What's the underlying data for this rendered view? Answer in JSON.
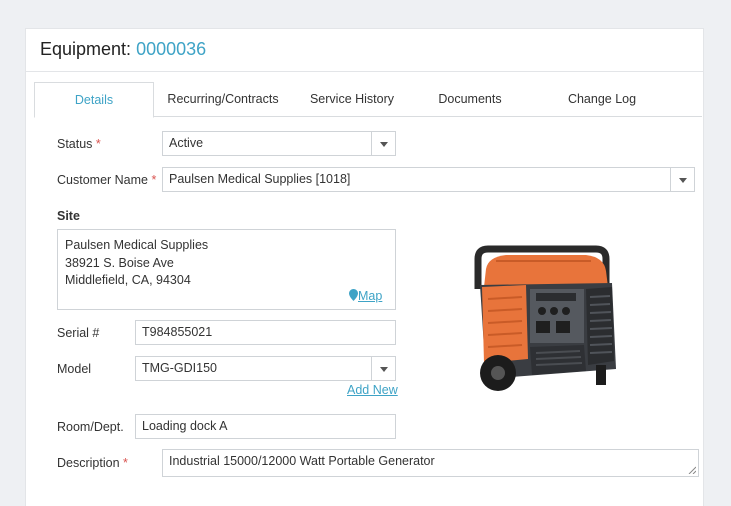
{
  "header": {
    "title": "Equipment:",
    "number": "0000036"
  },
  "tabs": [
    {
      "label": "Details",
      "active": true
    },
    {
      "label": "Recurring/Contracts",
      "active": false
    },
    {
      "label": "Service History",
      "active": false
    },
    {
      "label": "Documents",
      "active": false
    },
    {
      "label": "Change Log",
      "active": false
    }
  ],
  "form": {
    "status": {
      "label": "Status",
      "required": "*",
      "value": "Active"
    },
    "customer": {
      "label": "Customer Name",
      "required": "*",
      "value": "Paulsen Medical Supplies [1018]"
    },
    "site": {
      "label": "Site",
      "line1": "Paulsen Medical Supplies",
      "line2": "38921 S. Boise Ave",
      "line3": "Middlefield, CA, 94304",
      "map_link": "Map"
    },
    "serial": {
      "label": "Serial #",
      "value": "T984855021"
    },
    "model": {
      "label": "Model",
      "value": "TMG-GDI150",
      "add_new": "Add New"
    },
    "room": {
      "label": "Room/Dept.",
      "value": "Loading dock A"
    },
    "description": {
      "label": "Description",
      "required": "*",
      "value": "Industrial 15000/12000 Watt Portable Generator"
    }
  },
  "colors": {
    "accent": "#3ea3c6",
    "required": "#d9534f",
    "generator_orange": "#e8743b"
  },
  "icons": {
    "map": "map-pin-icon",
    "dropdown": "caret-down-icon"
  }
}
